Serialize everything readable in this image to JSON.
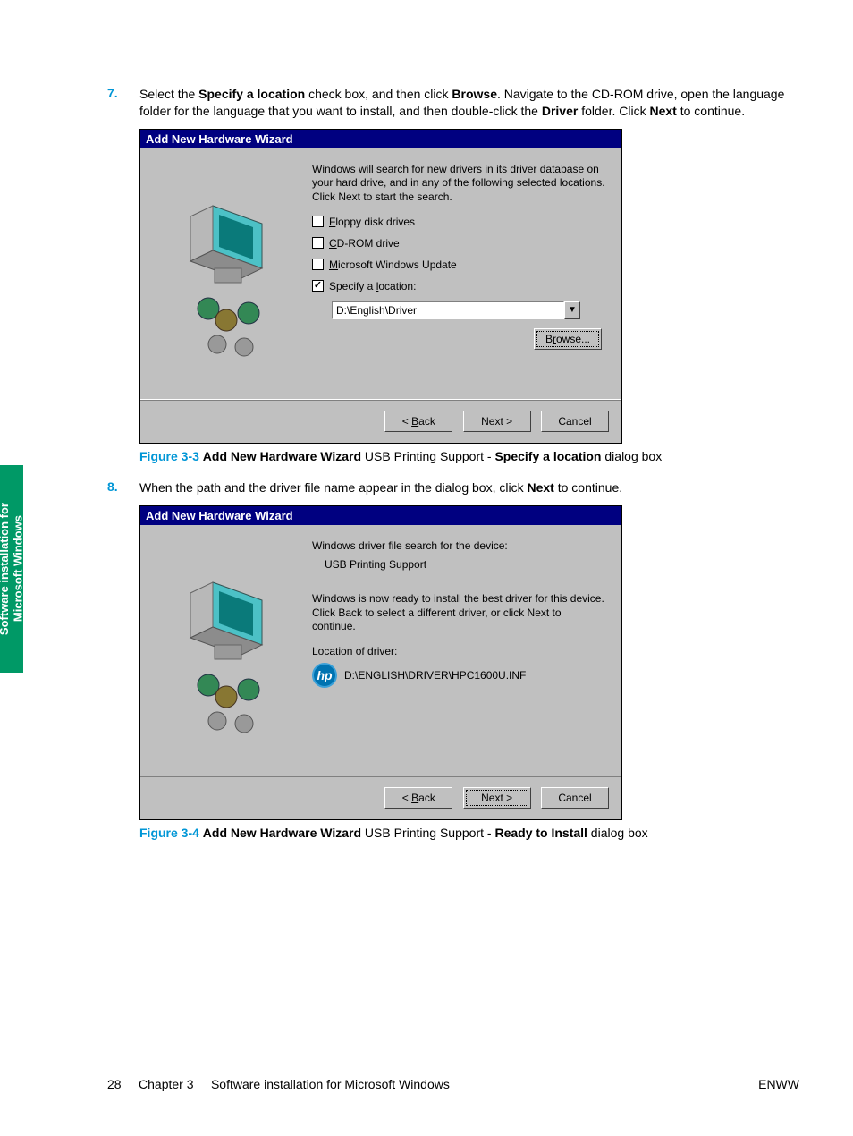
{
  "steps": {
    "s7": {
      "num": "7.",
      "pre": "Select the ",
      "b1": "Specify a location",
      "mid1": " check box, and then click ",
      "b2": "Browse",
      "mid2": ". Navigate to the CD-ROM drive, open the language folder for the language that you want to install, and then double-click the ",
      "b3": "Driver",
      "mid3": " folder. Click ",
      "b4": "Next",
      "end": " to continue."
    },
    "s8": {
      "num": "8.",
      "pre": "When the path and the driver file name appear in the dialog box, click ",
      "b1": "Next",
      "end": " to continue."
    }
  },
  "dlg1": {
    "title": "Add New Hardware Wizard",
    "desc": "Windows will search for new drivers in its driver database on your hard drive, and in any of the following selected locations. Click Next to start the search.",
    "chk_floppy_u": "F",
    "chk_floppy_rest": "loppy disk drives",
    "chk_cd_u": "C",
    "chk_cd_rest": "D-ROM drive",
    "chk_wu_u": "M",
    "chk_wu_rest": "icrosoft Windows Update",
    "chk_loc_pre": "Specify a ",
    "chk_loc_u": "l",
    "chk_loc_rest": "ocation:",
    "path": "D:\\English\\Driver",
    "browse_pre": "B",
    "browse_u": "r",
    "browse_rest": "owse...",
    "back_pre": "< ",
    "back_u": "B",
    "back_rest": "ack",
    "next": "Next >",
    "cancel": "Cancel"
  },
  "caption1": {
    "fig": "Figure 3-3",
    "sp": "  ",
    "b1": "Add New Hardware Wizard",
    "mid": " USB Printing Support - ",
    "b2": "Specify a location",
    "end": " dialog box"
  },
  "dlg2": {
    "title": "Add New Hardware Wizard",
    "line1": "Windows driver file search for the device:",
    "device": "USB Printing Support",
    "ready": "Windows is now ready to install the best driver for this device. Click Back to select a different driver, or click Next to continue.",
    "loc_label": "Location of driver:",
    "loc_path": "D:\\ENGLISH\\DRIVER\\HPC1600U.INF",
    "back_pre": "< ",
    "back_u": "B",
    "back_rest": "ack",
    "next": "Next >",
    "cancel": "Cancel"
  },
  "caption2": {
    "fig": "Figure 3-4",
    "sp": "  ",
    "b1": "Add New Hardware Wizard",
    "mid": " USB Printing Support - ",
    "b2": "Ready to Install",
    "end": " dialog box"
  },
  "sidetab": "Software installation for\nMicrosoft Windows",
  "footer": {
    "left_page": "28",
    "left_chapter": "Chapter 3",
    "left_title": "Software installation for Microsoft Windows",
    "right": "ENWW"
  }
}
